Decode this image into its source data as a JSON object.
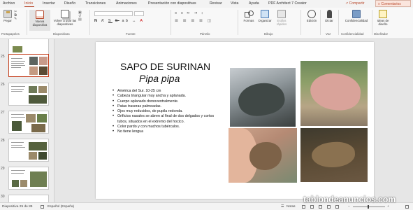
{
  "tabs": [
    "Archivo",
    "Inicio",
    "Insertar",
    "Diseño",
    "Transiciones",
    "Animaciones",
    "Presentación con diapositivas",
    "Revisar",
    "Vista",
    "Ayuda",
    "PDF Architect 7 Creator"
  ],
  "share_label": "Compartir",
  "comments_label": "Comentarios",
  "ribbon": {
    "paste": "Pegar",
    "new_slide": "Nueva diapositiva",
    "reuse_slides": "Volver a usar las diapositivas",
    "shapes": "Formas",
    "arrange": "Organizar",
    "quick_styles": "Estilos rápidos",
    "editing": "Edición",
    "dictate": "Dictar",
    "confidentiality": "Confidencialidad",
    "design_ideas": "Ideas de diseño",
    "groups": {
      "clipboard": "Portapapeles",
      "slides": "Diapositivas",
      "font": "Fuente",
      "paragraph": "Párrafo",
      "drawing": "Dibujo",
      "voice": "Voz",
      "confidentiality": "Confidencialidad",
      "designer": "Diseñador"
    }
  },
  "thumbnails": {
    "numbers": [
      "25",
      "26",
      "27",
      "28",
      "29",
      "30"
    ],
    "selected": "25"
  },
  "slide": {
    "title": "SAPO DE SURINAN",
    "subtitle": "Pipa pipa",
    "bullets": [
      "América del Sur. 10-25 cm",
      "Cabeza triangular muy ancha y aplanada.",
      "Cuerpo aplanado dorsoventralmente.",
      "Patas traseras palmeadas.",
      "Ojos muy reducidos, de pupila redonda.",
      "Orificios nasales se abren al final de dos delgados y cortos tubos, situados en el extremo del hocico.",
      "Color pardo y con muchos tubérculos.",
      "No tiene lengua"
    ]
  },
  "status": {
    "slide_counter": "Diapositiva 25 de 89",
    "language": "Español (España)",
    "notes": "Notas"
  },
  "watermark": "tablondeanuncios.com"
}
